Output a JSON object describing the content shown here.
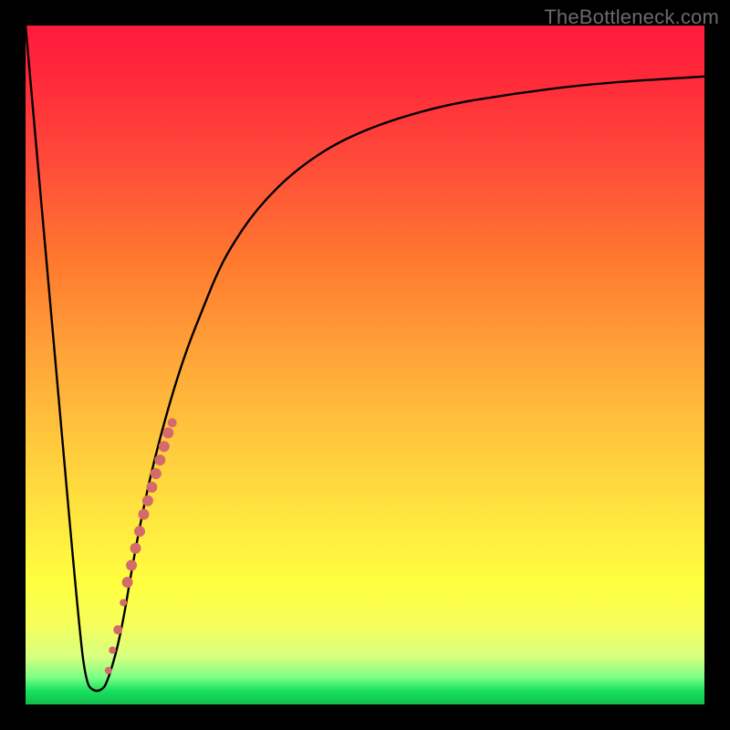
{
  "watermark": "TheBottleneck.com",
  "chart_data": {
    "type": "line",
    "title": "",
    "xlabel": "",
    "ylabel": "",
    "xlim": [
      0,
      100
    ],
    "ylim": [
      0,
      100
    ],
    "series": [
      {
        "name": "bottleneck-curve",
        "x": [
          0,
          4,
          8,
          9,
          10,
          11,
          12,
          14,
          16,
          18,
          20,
          22,
          24,
          26,
          28,
          30,
          34,
          40,
          48,
          60,
          72,
          84,
          100
        ],
        "y": [
          100,
          55,
          10,
          3,
          2,
          2,
          3,
          10,
          22,
          32,
          40,
          47,
          53,
          58,
          63,
          67,
          73,
          79,
          84,
          88,
          90,
          91.5,
          92.5
        ]
      }
    ],
    "markers": [
      {
        "name": "segment-highlight",
        "color": "#d46a6a",
        "points": [
          {
            "x": 12.2,
            "y": 5,
            "r": 4
          },
          {
            "x": 12.8,
            "y": 8,
            "r": 4
          },
          {
            "x": 13.6,
            "y": 11,
            "r": 5
          },
          {
            "x": 14.4,
            "y": 15,
            "r": 4
          },
          {
            "x": 15,
            "y": 18,
            "r": 6
          },
          {
            "x": 15.6,
            "y": 20.5,
            "r": 6
          },
          {
            "x": 16.2,
            "y": 23,
            "r": 6
          },
          {
            "x": 16.8,
            "y": 25.5,
            "r": 6
          },
          {
            "x": 17.4,
            "y": 28,
            "r": 6
          },
          {
            "x": 18,
            "y": 30,
            "r": 6
          },
          {
            "x": 18.6,
            "y": 32,
            "r": 6
          },
          {
            "x": 19.2,
            "y": 34,
            "r": 6
          },
          {
            "x": 19.8,
            "y": 36,
            "r": 6
          },
          {
            "x": 20.4,
            "y": 38,
            "r": 6
          },
          {
            "x": 21,
            "y": 40,
            "r": 6
          },
          {
            "x": 21.6,
            "y": 41.5,
            "r": 5
          }
        ]
      }
    ]
  }
}
